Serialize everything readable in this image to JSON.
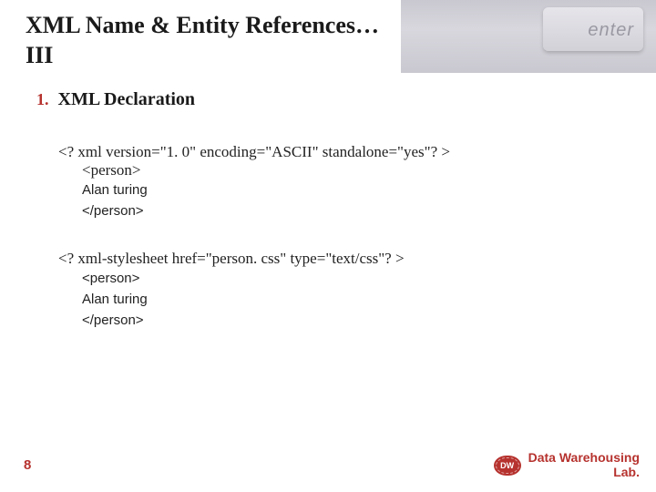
{
  "header": {
    "title_line1": "XML Name & Entity References…",
    "title_line2": "III",
    "bg_key_label": "enter"
  },
  "section": {
    "number": "1.",
    "title": "XML Declaration"
  },
  "block1": {
    "decl": "<? xml version=\"1. 0\" encoding=\"ASCII\" standalone=\"yes\"? >",
    "open": "<person>",
    "body": "Alan turing",
    "close": "</person>"
  },
  "block2": {
    "decl": "<? xml-stylesheet href=\"person. css\" type=\"text/css\"? >",
    "open": "<person>",
    "body": "Alan turing",
    "close": "</person>"
  },
  "footer": {
    "page": "8",
    "logo_text": "DW",
    "label_line1": "Data Warehousing",
    "label_line2": "Lab."
  }
}
